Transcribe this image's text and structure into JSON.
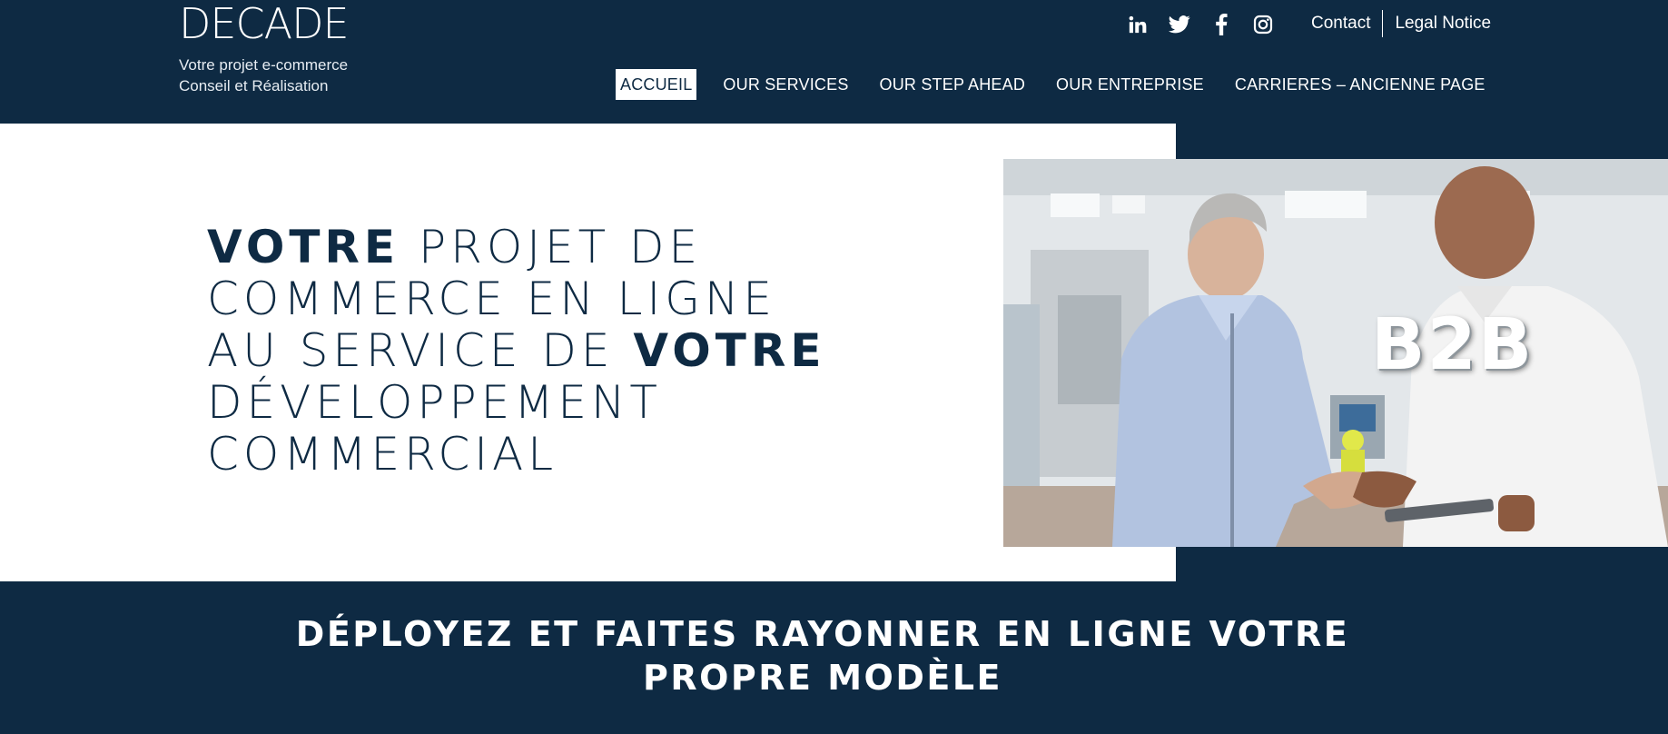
{
  "brand": {
    "logo": "DECADE",
    "tagline_line1": "Votre projet e-commerce",
    "tagline_line2": "Conseil et Réalisation"
  },
  "social": [
    {
      "name": "linkedin-icon"
    },
    {
      "name": "twitter-icon"
    },
    {
      "name": "facebook-icon"
    },
    {
      "name": "instagram-icon"
    }
  ],
  "util_links": {
    "contact": "Contact",
    "legal": "Legal Notice"
  },
  "nav": {
    "items": [
      {
        "label": "ACCUEIL",
        "active": true
      },
      {
        "label": "OUR SERVICES"
      },
      {
        "label": "OUR STEP AHEAD"
      },
      {
        "label": "OUR ENTREPRISE"
      },
      {
        "label": "CARRIERES – ANCIENNE PAGE"
      }
    ]
  },
  "hero": {
    "title_parts": [
      "VOTRE",
      "PROJET DE COMMERCE EN LIGNE AU SERVICE DE",
      "VOTRE",
      "DÉVELOPPEMENT COMMERCIAL"
    ],
    "image_overlay": "B2B"
  },
  "band": {
    "line1": "DÉPLOYEZ ET FAITES RAYONNER EN LIGNE VOTRE",
    "line2": "PROPRE MODÈLE"
  },
  "colors": {
    "navy": "#0e2a43",
    "white": "#ffffff"
  }
}
